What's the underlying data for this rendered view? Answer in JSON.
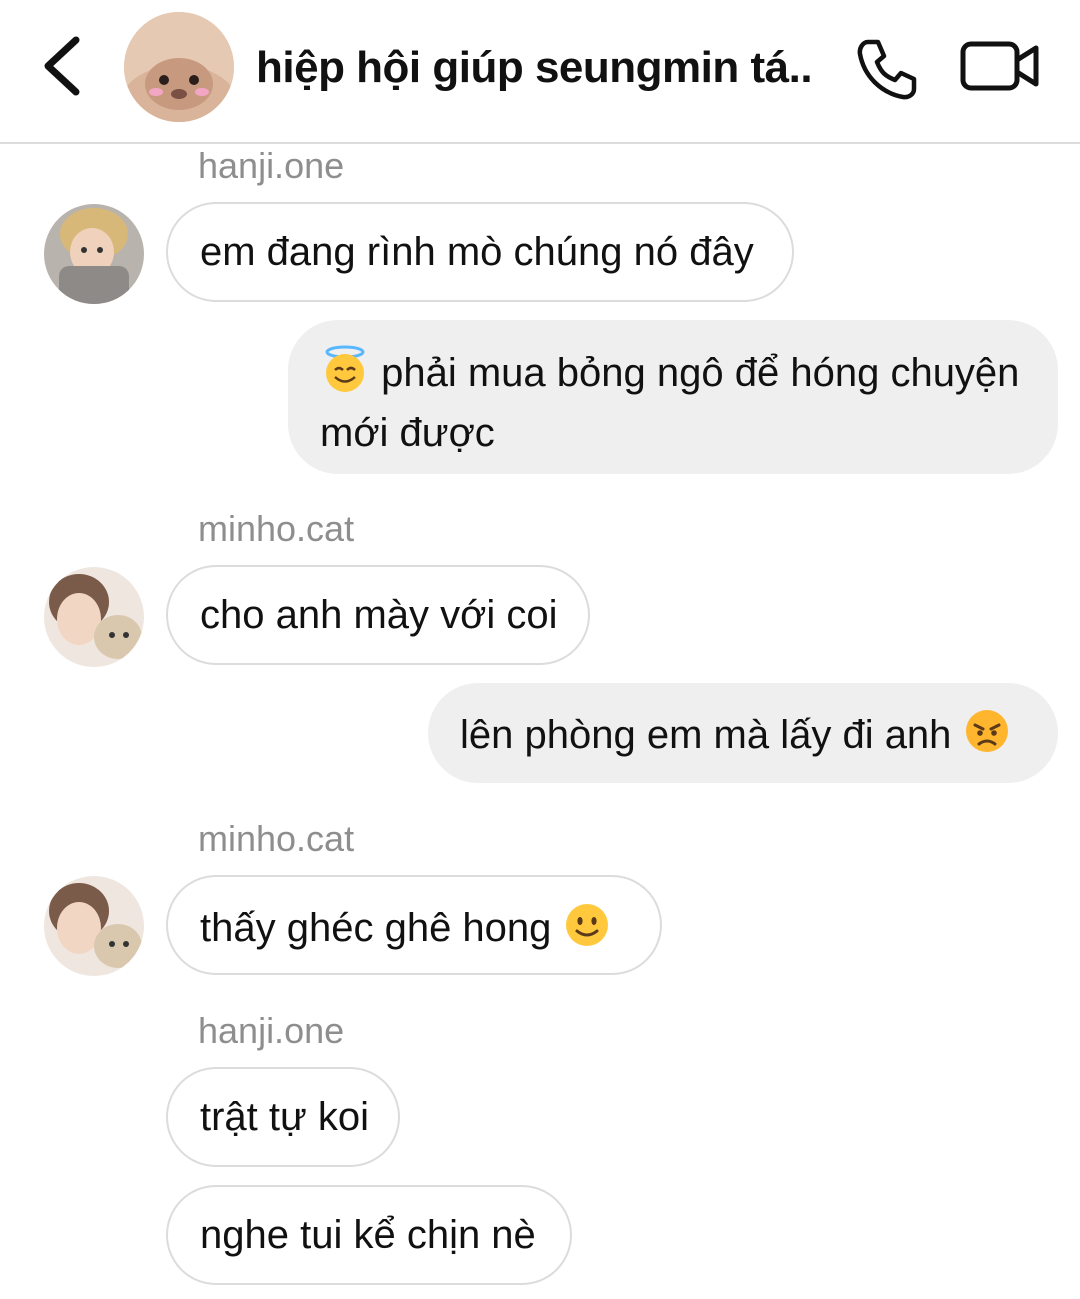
{
  "header": {
    "back_icon": "chevron-left-icon",
    "title": "hiệp hội giúp seungmin tá..",
    "call_icon": "phone-icon",
    "video_icon": "video-camera-icon"
  },
  "messages": [
    {
      "sender": "hanji.one",
      "text": "em đang rình mò chúng nó đây"
    },
    {
      "emoji": "smiling-face-with-halo-icon",
      "text": "phải mua bỏng ngô để hóng chuyện mới được"
    },
    {
      "sender": "minho.cat",
      "text": "cho anh mày với coi"
    },
    {
      "text": "lên phòng em mà lấy đi anh",
      "emoji": "angry-face-icon"
    },
    {
      "sender": "minho.cat",
      "text": "thấy ghéc ghê hong",
      "emoji": "slightly-smiling-face-icon"
    },
    {
      "sender": "hanji.one",
      "text": "trật tự koi"
    },
    {
      "text": "nghe tui kể chịn nè"
    }
  ]
}
